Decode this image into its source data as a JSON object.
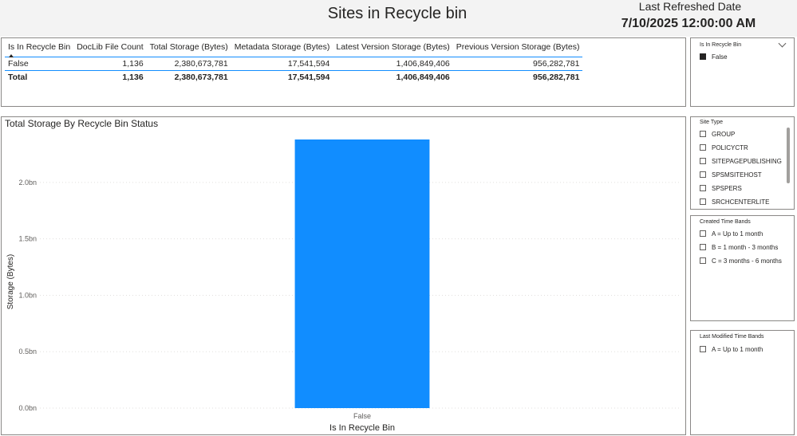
{
  "header": {
    "title": "Sites in Recycle bin",
    "refresh_label": "Last Refreshed Date",
    "refresh_value": "7/10/2025 12:00:00 AM"
  },
  "table": {
    "columns": [
      "Is In Recycle Bin",
      "DocLib File Count",
      "Total Storage (Bytes)",
      "Metadata Storage (Bytes)",
      "Latest Version Storage (Bytes)",
      "Previous Version Storage (Bytes)"
    ],
    "rows": [
      [
        "False",
        "1,136",
        "2,380,673,781",
        "17,541,594",
        "1,406,849,406",
        "956,282,781"
      ]
    ],
    "total": [
      "Total",
      "1,136",
      "2,380,673,781",
      "17,541,594",
      "1,406,849,406",
      "956,282,781"
    ]
  },
  "chart_data": {
    "type": "bar",
    "title": "Total Storage By Recycle Bin Status",
    "xlabel": "Is In Recycle Bin",
    "ylabel": "Storage (Bytes)",
    "categories": [
      "False"
    ],
    "values": [
      2380673781
    ],
    "yticks": [
      "0.0bn",
      "0.5bn",
      "1.0bn",
      "1.5bn",
      "2.0bn"
    ],
    "ytick_values": [
      0,
      500000000,
      1000000000,
      1500000000,
      2000000000
    ],
    "ylim": [
      0,
      2380673781
    ],
    "grid": true,
    "bar_color": "#118dff"
  },
  "slicers": {
    "recycle_bin": {
      "title": "Is In Recycle Bin",
      "items": [
        {
          "label": "False",
          "checked": true
        }
      ]
    },
    "site_type": {
      "title": "Site Type",
      "items": [
        "GROUP",
        "POLICYCTR",
        "SITEPAGEPUBLISHING",
        "SPSMSITEHOST",
        "SPSPERS",
        "SRCHCENTERLITE"
      ]
    },
    "created": {
      "title": "Created Time Bands",
      "items": [
        "A = Up to 1 month",
        "B = 1 month - 3 months",
        "C = 3 months - 6 months"
      ]
    },
    "modified": {
      "title": "Last Modified Time Bands",
      "items": [
        "A = Up to 1 month"
      ]
    }
  }
}
